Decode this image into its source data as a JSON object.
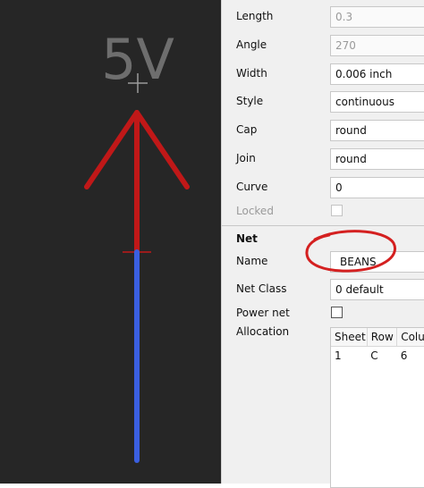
{
  "canvas": {
    "net_label": "5V",
    "arrow_color": "#c01818",
    "wire_color": "#3a5fe0",
    "background": "#262626"
  },
  "properties": {
    "length": {
      "label": "Length",
      "value": "0.3"
    },
    "angle": {
      "label": "Angle",
      "value": "270"
    },
    "width": {
      "label": "Width",
      "value": "0.006 inch"
    },
    "style": {
      "label": "Style",
      "value": "continuous"
    },
    "cap": {
      "label": "Cap",
      "value": "round"
    },
    "join": {
      "label": "Join",
      "value": "round"
    },
    "curve": {
      "label": "Curve",
      "value": "0"
    },
    "locked": {
      "label": "Locked",
      "checked": false
    }
  },
  "net": {
    "section_title": "Net",
    "name": {
      "label": "Name",
      "value": "BEANS"
    },
    "net_class": {
      "label": "Net Class",
      "value": "0 default"
    },
    "power_net": {
      "label": "Power net",
      "checked": false
    },
    "allocation": {
      "label": "Allocation",
      "columns": [
        "Sheet",
        "Row",
        "Colur"
      ],
      "rows": [
        [
          "1",
          "C",
          "6"
        ]
      ]
    }
  },
  "annotation_color": "#d42020"
}
